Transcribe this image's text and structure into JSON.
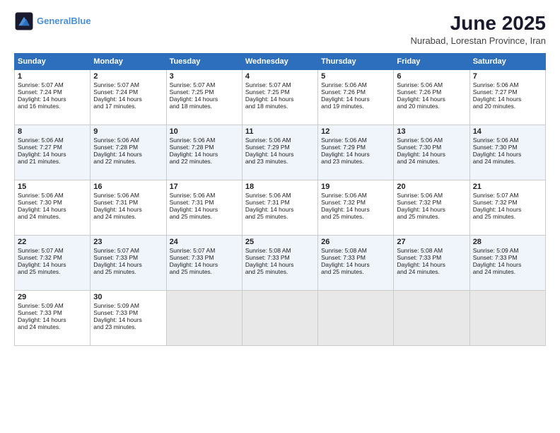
{
  "header": {
    "logo_line1": "General",
    "logo_line2": "Blue",
    "title": "June 2025",
    "subtitle": "Nurabad, Lorestan Province, Iran"
  },
  "weekdays": [
    "Sunday",
    "Monday",
    "Tuesday",
    "Wednesday",
    "Thursday",
    "Friday",
    "Saturday"
  ],
  "rows": [
    [
      {
        "day": "1",
        "lines": [
          "Sunrise: 5:07 AM",
          "Sunset: 7:24 PM",
          "Daylight: 14 hours",
          "and 16 minutes."
        ]
      },
      {
        "day": "2",
        "lines": [
          "Sunrise: 5:07 AM",
          "Sunset: 7:24 PM",
          "Daylight: 14 hours",
          "and 17 minutes."
        ]
      },
      {
        "day": "3",
        "lines": [
          "Sunrise: 5:07 AM",
          "Sunset: 7:25 PM",
          "Daylight: 14 hours",
          "and 18 minutes."
        ]
      },
      {
        "day": "4",
        "lines": [
          "Sunrise: 5:07 AM",
          "Sunset: 7:25 PM",
          "Daylight: 14 hours",
          "and 18 minutes."
        ]
      },
      {
        "day": "5",
        "lines": [
          "Sunrise: 5:06 AM",
          "Sunset: 7:26 PM",
          "Daylight: 14 hours",
          "and 19 minutes."
        ]
      },
      {
        "day": "6",
        "lines": [
          "Sunrise: 5:06 AM",
          "Sunset: 7:26 PM",
          "Daylight: 14 hours",
          "and 20 minutes."
        ]
      },
      {
        "day": "7",
        "lines": [
          "Sunrise: 5:06 AM",
          "Sunset: 7:27 PM",
          "Daylight: 14 hours",
          "and 20 minutes."
        ]
      }
    ],
    [
      {
        "day": "8",
        "lines": [
          "Sunrise: 5:06 AM",
          "Sunset: 7:27 PM",
          "Daylight: 14 hours",
          "and 21 minutes."
        ]
      },
      {
        "day": "9",
        "lines": [
          "Sunrise: 5:06 AM",
          "Sunset: 7:28 PM",
          "Daylight: 14 hours",
          "and 22 minutes."
        ]
      },
      {
        "day": "10",
        "lines": [
          "Sunrise: 5:06 AM",
          "Sunset: 7:28 PM",
          "Daylight: 14 hours",
          "and 22 minutes."
        ]
      },
      {
        "day": "11",
        "lines": [
          "Sunrise: 5:06 AM",
          "Sunset: 7:29 PM",
          "Daylight: 14 hours",
          "and 23 minutes."
        ]
      },
      {
        "day": "12",
        "lines": [
          "Sunrise: 5:06 AM",
          "Sunset: 7:29 PM",
          "Daylight: 14 hours",
          "and 23 minutes."
        ]
      },
      {
        "day": "13",
        "lines": [
          "Sunrise: 5:06 AM",
          "Sunset: 7:30 PM",
          "Daylight: 14 hours",
          "and 24 minutes."
        ]
      },
      {
        "day": "14",
        "lines": [
          "Sunrise: 5:06 AM",
          "Sunset: 7:30 PM",
          "Daylight: 14 hours",
          "and 24 minutes."
        ]
      }
    ],
    [
      {
        "day": "15",
        "lines": [
          "Sunrise: 5:06 AM",
          "Sunset: 7:30 PM",
          "Daylight: 14 hours",
          "and 24 minutes."
        ]
      },
      {
        "day": "16",
        "lines": [
          "Sunrise: 5:06 AM",
          "Sunset: 7:31 PM",
          "Daylight: 14 hours",
          "and 24 minutes."
        ]
      },
      {
        "day": "17",
        "lines": [
          "Sunrise: 5:06 AM",
          "Sunset: 7:31 PM",
          "Daylight: 14 hours",
          "and 25 minutes."
        ]
      },
      {
        "day": "18",
        "lines": [
          "Sunrise: 5:06 AM",
          "Sunset: 7:31 PM",
          "Daylight: 14 hours",
          "and 25 minutes."
        ]
      },
      {
        "day": "19",
        "lines": [
          "Sunrise: 5:06 AM",
          "Sunset: 7:32 PM",
          "Daylight: 14 hours",
          "and 25 minutes."
        ]
      },
      {
        "day": "20",
        "lines": [
          "Sunrise: 5:06 AM",
          "Sunset: 7:32 PM",
          "Daylight: 14 hours",
          "and 25 minutes."
        ]
      },
      {
        "day": "21",
        "lines": [
          "Sunrise: 5:07 AM",
          "Sunset: 7:32 PM",
          "Daylight: 14 hours",
          "and 25 minutes."
        ]
      }
    ],
    [
      {
        "day": "22",
        "lines": [
          "Sunrise: 5:07 AM",
          "Sunset: 7:32 PM",
          "Daylight: 14 hours",
          "and 25 minutes."
        ]
      },
      {
        "day": "23",
        "lines": [
          "Sunrise: 5:07 AM",
          "Sunset: 7:33 PM",
          "Daylight: 14 hours",
          "and 25 minutes."
        ]
      },
      {
        "day": "24",
        "lines": [
          "Sunrise: 5:07 AM",
          "Sunset: 7:33 PM",
          "Daylight: 14 hours",
          "and 25 minutes."
        ]
      },
      {
        "day": "25",
        "lines": [
          "Sunrise: 5:08 AM",
          "Sunset: 7:33 PM",
          "Daylight: 14 hours",
          "and 25 minutes."
        ]
      },
      {
        "day": "26",
        "lines": [
          "Sunrise: 5:08 AM",
          "Sunset: 7:33 PM",
          "Daylight: 14 hours",
          "and 25 minutes."
        ]
      },
      {
        "day": "27",
        "lines": [
          "Sunrise: 5:08 AM",
          "Sunset: 7:33 PM",
          "Daylight: 14 hours",
          "and 24 minutes."
        ]
      },
      {
        "day": "28",
        "lines": [
          "Sunrise: 5:09 AM",
          "Sunset: 7:33 PM",
          "Daylight: 14 hours",
          "and 24 minutes."
        ]
      }
    ],
    [
      {
        "day": "29",
        "lines": [
          "Sunrise: 5:09 AM",
          "Sunset: 7:33 PM",
          "Daylight: 14 hours",
          "and 24 minutes."
        ]
      },
      {
        "day": "30",
        "lines": [
          "Sunrise: 5:09 AM",
          "Sunset: 7:33 PM",
          "Daylight: 14 hours",
          "and 23 minutes."
        ]
      },
      {
        "day": "",
        "lines": []
      },
      {
        "day": "",
        "lines": []
      },
      {
        "day": "",
        "lines": []
      },
      {
        "day": "",
        "lines": []
      },
      {
        "day": "",
        "lines": []
      }
    ]
  ]
}
